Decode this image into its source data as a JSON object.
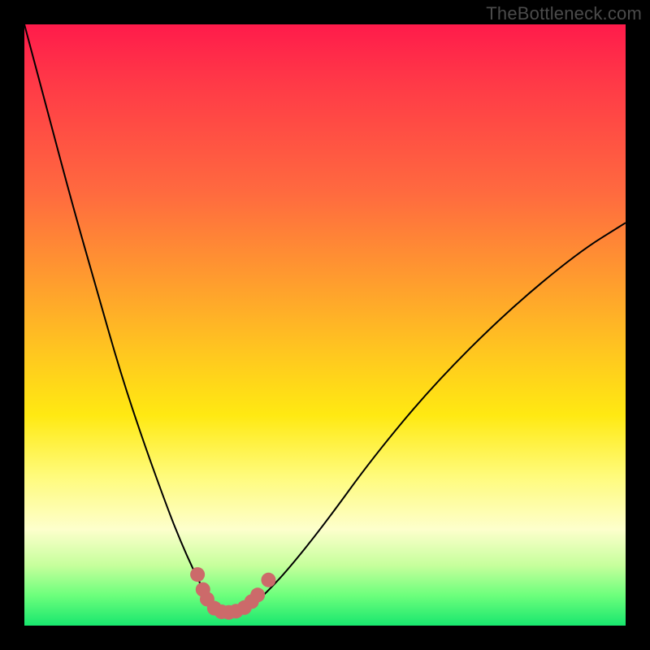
{
  "watermark": "TheBottleneck.com",
  "colors": {
    "frame": "#000000",
    "curve": "#000000",
    "marker": "#cc6a6a",
    "gradient_top": "#ff1b4b",
    "gradient_bottom": "#18e66e"
  },
  "chart_data": {
    "type": "line",
    "title": "",
    "xlabel": "",
    "ylabel": "",
    "xlim": [
      0,
      100
    ],
    "ylim": [
      0,
      100
    ],
    "grid": false,
    "x": [
      0,
      4,
      8,
      12,
      16,
      20,
      24,
      26,
      28,
      30,
      31,
      32,
      33,
      34,
      35,
      36,
      38,
      40,
      44,
      50,
      58,
      68,
      80,
      92,
      100
    ],
    "y": [
      100,
      85,
      70,
      56,
      42,
      30,
      19,
      14,
      9.5,
      5.5,
      4,
      3,
      2.4,
      2.2,
      2.2,
      2.6,
      3.6,
      5.2,
      9.5,
      17,
      28,
      40,
      52,
      62,
      67
    ],
    "markers": [
      {
        "x": 28.8,
        "y": 8.5
      },
      {
        "x": 29.7,
        "y": 6.0
      },
      {
        "x": 30.4,
        "y": 4.4
      },
      {
        "x": 31.6,
        "y": 2.9
      },
      {
        "x": 32.8,
        "y": 2.3
      },
      {
        "x": 34.0,
        "y": 2.2
      },
      {
        "x": 35.2,
        "y": 2.4
      },
      {
        "x": 36.6,
        "y": 3.0
      },
      {
        "x": 37.8,
        "y": 4.0
      },
      {
        "x": 38.8,
        "y": 5.1
      },
      {
        "x": 40.6,
        "y": 7.6
      }
    ],
    "annotations": []
  }
}
